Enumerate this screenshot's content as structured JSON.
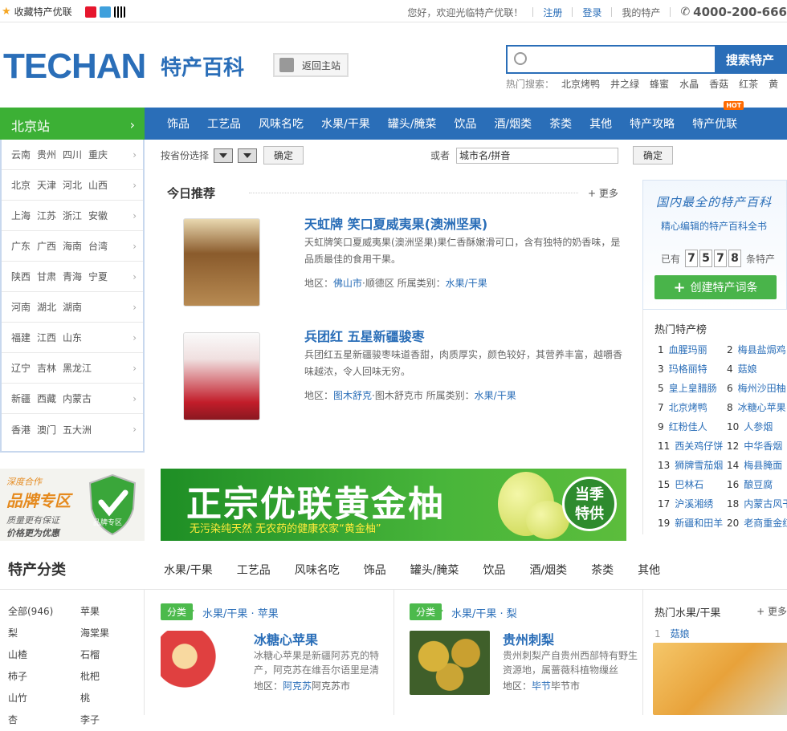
{
  "topbar": {
    "favorite": "收藏特产优联",
    "welcome": "您好，欢迎光临特产优联！",
    "register": "注册",
    "login": "登录",
    "my": "我的特产",
    "phone": "4000-200-666"
  },
  "header": {
    "logo": "TECHAN",
    "subtitle": "特产百科",
    "home": "返回主站",
    "search_button": "搜索特产",
    "hot_label": "热门搜索：",
    "hot_terms": [
      "北京烤鸭",
      "井之绿",
      "蜂蜜",
      "水晶",
      "香菇",
      "红茶",
      "黄"
    ]
  },
  "station": "北京站",
  "nav": [
    "饰品",
    "工艺品",
    "风味名吃",
    "水果/干果",
    "罐头/腌菜",
    "饮品",
    "酒/烟类",
    "茶类",
    "其他",
    "特产攻略",
    "特产优联"
  ],
  "nav_hot": "HOT",
  "regions": [
    [
      "云南",
      "贵州",
      "四川",
      "重庆"
    ],
    [
      "北京",
      "天津",
      "河北",
      "山西"
    ],
    [
      "上海",
      "江苏",
      "浙江",
      "安徽"
    ],
    [
      "广东",
      "广西",
      "海南",
      "台湾"
    ],
    [
      "陕西",
      "甘肃",
      "青海",
      "宁夏"
    ],
    [
      "河南",
      "湖北",
      "湖南"
    ],
    [
      "福建",
      "江西",
      "山东"
    ],
    [
      "辽宁",
      "吉林",
      "黑龙江"
    ],
    [
      "新疆",
      "西藏",
      "内蒙古"
    ],
    [
      "香港",
      "澳门",
      "五大洲"
    ]
  ],
  "filter": {
    "province_label": "按省份选择",
    "ok": "确定",
    "or": "或者",
    "city_value": "城市名/拼音"
  },
  "today": {
    "title": "今日推荐",
    "more": "+ 更多",
    "items": [
      {
        "title": "天虹牌 笑口夏威夷果(澳洲坚果)",
        "desc": "天虹牌笑口夏威夷果(澳洲坚果)果仁香酥嫩滑可口，含有独特的奶香味，是品质最佳的食用干果。",
        "region_label": "地区：",
        "region_link": "佛山市",
        "region_rest": "·顺德区 所属类别：",
        "cat": "水果/干果"
      },
      {
        "title": "兵团红 五星新疆骏枣",
        "desc": "兵团红五星新疆骏枣味道香甜，肉质厚实，颜色较好，其营养丰富，越嚼香味越浓，令人回味无穷。",
        "region_label": "地区：",
        "region_link": "图木舒克",
        "region_rest": "·图木舒克市 所属类别：",
        "cat": "水果/干果"
      }
    ]
  },
  "rpanel": {
    "slogan": "国内最全的特产百科",
    "sub": "精心编辑的特产百科全书",
    "count_pre": "已有",
    "digits": [
      "7",
      "5",
      "7",
      "8"
    ],
    "count_post": "条特产",
    "create": "创建特产词条"
  },
  "rank": {
    "title": "热门特产榜",
    "items": [
      "血腥玛丽",
      "梅县盐焗鸡",
      "玛格丽特",
      "菇娘",
      "皇上皇腊肠",
      "梅州沙田柚",
      "北京烤鸭",
      "冰糖心苹果",
      "红粉佳人",
      "人参烟",
      "西关鸡仔饼",
      "中华香烟",
      "狮牌雪茄烟",
      "梅县腌面",
      "巴林石",
      "酿豆腐",
      "沪溪湘绣",
      "内蒙古风干",
      "新疆和田羊",
      "老商重金红"
    ]
  },
  "brand": {
    "line1": "深度合作",
    "line2": "品牌专区",
    "line3": "质量更有保证",
    "line4": "价格更为优惠",
    "badge": "品牌专区"
  },
  "banner": {
    "big": "正宗优联黄金柚",
    "small": "无污染纯天然 无农药的健康农家“黄金柚”",
    "stamp1": "当季",
    "stamp2": "特供"
  },
  "categories": {
    "title": "特产分类",
    "tabs": [
      "水果/干果",
      "工艺品",
      "风味名吃",
      "饰品",
      "罐头/腌菜",
      "饮品",
      "酒/烟类",
      "茶类",
      "其他"
    ],
    "side": [
      "全部(946)",
      "苹果",
      "梨",
      "海棠果",
      "山楂",
      "石榴",
      "柿子",
      "枇杷",
      "山竹",
      "桃",
      "杏",
      "李子"
    ]
  },
  "cards": [
    {
      "tag": "分类",
      "cls": "水果/干果 · 苹果",
      "title": "冰糖心苹果",
      "desc": "冰糖心苹果是新疆阿苏克的特产，阿克苏在维吾尔语里是清",
      "region_label": "地区：",
      "region_link": "阿克苏",
      "region_rest": "阿克苏市"
    },
    {
      "tag": "分类",
      "cls": "水果/干果 · 梨",
      "title": "贵州刺梨",
      "desc": "贵州刺梨产自贵州西部特有野生资源地，属蔷薇科植物缫丝",
      "region_label": "地区：",
      "region_link": "毕节",
      "region_rest": "毕节市"
    }
  ],
  "hot2": {
    "title": "热门水果/干果",
    "more": "+ 更多",
    "first_no": "1",
    "first_name": "菇娘"
  },
  "colors": {
    "brand_blue": "#2a6eb8",
    "green": "#3cb035",
    "orange": "#ff6a00"
  }
}
